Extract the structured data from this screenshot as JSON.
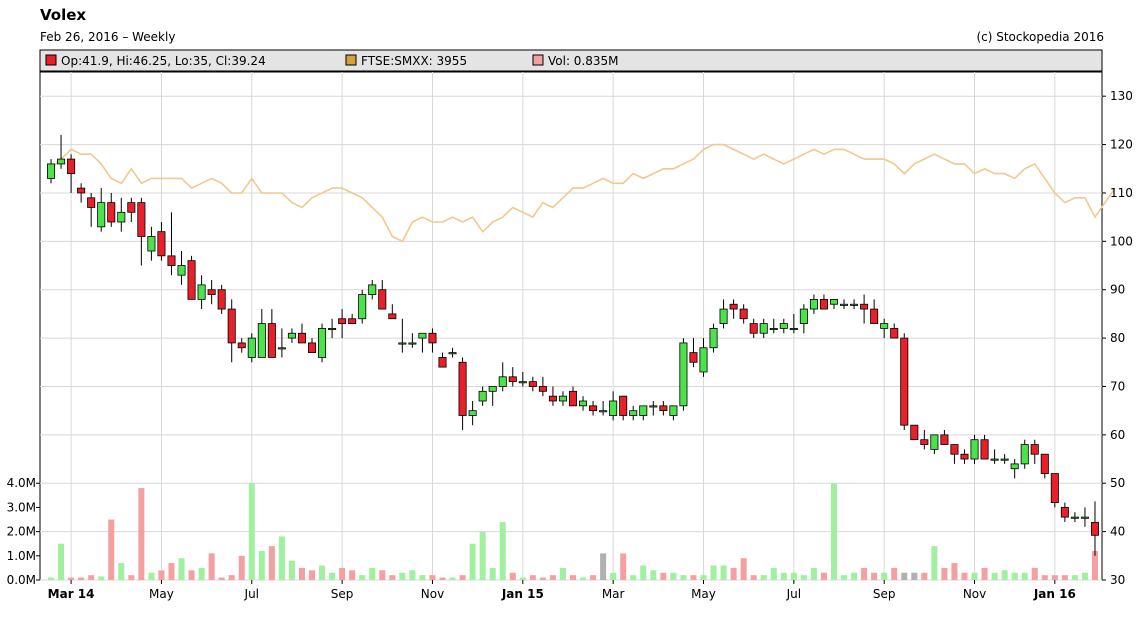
{
  "header": {
    "title": "Volex",
    "subtitle": "Feb 26, 2016 – Weekly",
    "credit": "(c) Stockopedia 2016"
  },
  "legend": [
    {
      "label": "Op:41.9, Hi:46.25, Lo:35, Cl:39.24",
      "color": "#e8202a"
    },
    {
      "label": "FTSE:SMXX: 3955",
      "color": "#d4a040"
    },
    {
      "label": "Vol: 0.835M",
      "color": "#f4a0a0"
    }
  ],
  "colors": {
    "up": "#4ce24c",
    "down": "#e8202a",
    "index_line": "#f0c890",
    "vol_up": "#a0f0a0",
    "vol_down": "#f4a0a0",
    "vol_neutral": "#b0b0b0",
    "grid": "#d8d8d8",
    "legend_bg": "#e4e4e4"
  },
  "chart_data": {
    "type": "candlestick",
    "price_axis": {
      "min": 30,
      "max": 135,
      "ticks": [
        "130",
        "120",
        "110",
        "100",
        "90",
        "80",
        "70",
        "60",
        "50",
        "40",
        "30"
      ],
      "side": "right"
    },
    "volume_axis": {
      "min": 0,
      "max": 4.0,
      "unit": "M",
      "ticks": [
        "4.0M",
        "3.0M",
        "2.0M",
        "1.0M",
        "0.0M"
      ],
      "side": "left"
    },
    "x_ticks": [
      {
        "label": "Mar 14",
        "bold": true,
        "week": 2
      },
      {
        "label": "May",
        "bold": false,
        "week": 11
      },
      {
        "label": "Jul",
        "bold": false,
        "week": 20
      },
      {
        "label": "Sep",
        "bold": false,
        "week": 29
      },
      {
        "label": "Nov",
        "bold": false,
        "week": 38
      },
      {
        "label": "Jan 15",
        "bold": true,
        "week": 47
      },
      {
        "label": "Mar",
        "bold": false,
        "week": 56
      },
      {
        "label": "May",
        "bold": false,
        "week": 65
      },
      {
        "label": "Jul",
        "bold": false,
        "week": 74
      },
      {
        "label": "Sep",
        "bold": false,
        "week": 83
      },
      {
        "label": "Nov",
        "bold": false,
        "week": 92
      },
      {
        "label": "Jan 16",
        "bold": true,
        "week": 100
      }
    ],
    "ohlc": [
      [
        113,
        117,
        112,
        116
      ],
      [
        116,
        122,
        115,
        117
      ],
      [
        117,
        118,
        110,
        114
      ],
      [
        111,
        112,
        108,
        110
      ],
      [
        109,
        110,
        103,
        107
      ],
      [
        103,
        111,
        102,
        108
      ],
      [
        108,
        110,
        103,
        104
      ],
      [
        104,
        109,
        102,
        106
      ],
      [
        108,
        109,
        104,
        106
      ],
      [
        108,
        109,
        95,
        101
      ],
      [
        98,
        103,
        96,
        101
      ],
      [
        102,
        104,
        96,
        97
      ],
      [
        97,
        106,
        93,
        95
      ],
      [
        93,
        98,
        91,
        95
      ],
      [
        96,
        97,
        88,
        88
      ],
      [
        88,
        93,
        86,
        91
      ],
      [
        90,
        92,
        87,
        89
      ],
      [
        90,
        91,
        85,
        86
      ],
      [
        86,
        88,
        75,
        79
      ],
      [
        79,
        80,
        77,
        78
      ],
      [
        76,
        81,
        75,
        80
      ],
      [
        76,
        86,
        76,
        83
      ],
      [
        83,
        86,
        76,
        76
      ],
      [
        78,
        82,
        76,
        78
      ],
      [
        80,
        82,
        79,
        81
      ],
      [
        81,
        83,
        79,
        79
      ],
      [
        79,
        80,
        77,
        77
      ],
      [
        76,
        83,
        75,
        82
      ],
      [
        82,
        84,
        80,
        82
      ],
      [
        84,
        86,
        80,
        83
      ],
      [
        84,
        85,
        83,
        83
      ],
      [
        84,
        90,
        83,
        89
      ],
      [
        89,
        92,
        88,
        91
      ],
      [
        90,
        92,
        86,
        86
      ],
      [
        85,
        87,
        84,
        84
      ],
      [
        79,
        84,
        77,
        79
      ],
      [
        79,
        81,
        78,
        79
      ],
      [
        80,
        81,
        77,
        81
      ],
      [
        81,
        82,
        77,
        79
      ],
      [
        76,
        77,
        74,
        74
      ],
      [
        77,
        78,
        76,
        77
      ],
      [
        75,
        76,
        61,
        64
      ],
      [
        64,
        67,
        62,
        65
      ],
      [
        67,
        70,
        66,
        69
      ],
      [
        69,
        70,
        66,
        70
      ],
      [
        70,
        75,
        69,
        72
      ],
      [
        72,
        74,
        70,
        71
      ],
      [
        71,
        73,
        70,
        71
      ],
      [
        71,
        72,
        69,
        70
      ],
      [
        70,
        72,
        68,
        69
      ],
      [
        68,
        70,
        66,
        67
      ],
      [
        67,
        69,
        66,
        68
      ],
      [
        69,
        70,
        66,
        66
      ],
      [
        66,
        68,
        65,
        67
      ],
      [
        66,
        67,
        64,
        65
      ],
      [
        65,
        67,
        64,
        65
      ],
      [
        64,
        69,
        63,
        67
      ],
      [
        68,
        68,
        63,
        64
      ],
      [
        64,
        66,
        63,
        65
      ],
      [
        64,
        66,
        63,
        66
      ],
      [
        66,
        67,
        64,
        66
      ],
      [
        66,
        67,
        64,
        65
      ],
      [
        64,
        66,
        63,
        66
      ],
      [
        66,
        80,
        65,
        79
      ],
      [
        77,
        80,
        74,
        75
      ],
      [
        73,
        80,
        72,
        78
      ],
      [
        78,
        83,
        77,
        82
      ],
      [
        83,
        88,
        82,
        86
      ],
      [
        87,
        88,
        84,
        86
      ],
      [
        86,
        87,
        83,
        84
      ],
      [
        83,
        84,
        80,
        81
      ],
      [
        81,
        84,
        80,
        83
      ],
      [
        82,
        84,
        81,
        82
      ],
      [
        82,
        84,
        81,
        83
      ],
      [
        82,
        85,
        81,
        82
      ],
      [
        83,
        87,
        81,
        86
      ],
      [
        86,
        89,
        85,
        88
      ],
      [
        88,
        89,
        86,
        86
      ],
      [
        87,
        88,
        86,
        88
      ],
      [
        87,
        88,
        86,
        87
      ],
      [
        87,
        88,
        86,
        87
      ],
      [
        87,
        89,
        83,
        86
      ],
      [
        86,
        88,
        83,
        83
      ],
      [
        82,
        84,
        80,
        83
      ],
      [
        82,
        83,
        80,
        80
      ],
      [
        80,
        81,
        61,
        62
      ],
      [
        62,
        62,
        59,
        59
      ],
      [
        59,
        61,
        57,
        58
      ],
      [
        57,
        60,
        56,
        60
      ],
      [
        60,
        61,
        58,
        58
      ],
      [
        58,
        58,
        54,
        56
      ],
      [
        56,
        57,
        54,
        55
      ],
      [
        55,
        60,
        54,
        59
      ],
      [
        59,
        60,
        55,
        55
      ],
      [
        55,
        57,
        54,
        55
      ],
      [
        55,
        56,
        54,
        55
      ],
      [
        53,
        55,
        51,
        54
      ],
      [
        54,
        59,
        53,
        58
      ],
      [
        58,
        59,
        54,
        56
      ],
      [
        56,
        56,
        51,
        52
      ],
      [
        52,
        52,
        45,
        46
      ],
      [
        45,
        46,
        42,
        43
      ],
      [
        43,
        44,
        42,
        43
      ],
      [
        43,
        45,
        41,
        43
      ],
      [
        41.9,
        46.25,
        35,
        39.24
      ]
    ],
    "volume_M": [
      0.1,
      1.5,
      0.1,
      0.1,
      0.2,
      0.15,
      2.5,
      0.7,
      0.2,
      3.8,
      0.3,
      0.4,
      0.7,
      0.9,
      0.4,
      0.5,
      1.1,
      0.1,
      0.2,
      1.0,
      4.0,
      1.2,
      1.4,
      1.8,
      0.8,
      0.5,
      0.4,
      0.6,
      0.3,
      0.5,
      0.4,
      0.2,
      0.5,
      0.4,
      0.2,
      0.3,
      0.4,
      0.2,
      0.2,
      0.1,
      0.1,
      0.2,
      1.5,
      2.0,
      0.5,
      2.4,
      0.3,
      0.1,
      0.2,
      0.1,
      0.2,
      0.5,
      0.2,
      0.1,
      0.2,
      1.1,
      0.3,
      1.1,
      0.2,
      0.6,
      0.4,
      0.3,
      0.3,
      0.2,
      0.2,
      0.2,
      0.6,
      0.6,
      0.5,
      0.9,
      0.2,
      0.2,
      0.5,
      0.3,
      0.3,
      0.2,
      0.5,
      0.3,
      4.0,
      0.2,
      0.3,
      0.5,
      0.3,
      0.3,
      0.5,
      0.3,
      0.3,
      0.3,
      1.4,
      0.5,
      0.7,
      0.3,
      0.3,
      0.5,
      0.3,
      0.4,
      0.3,
      0.3,
      0.5,
      0.2,
      0.2,
      0.2,
      0.2,
      0.3,
      1.2,
      0.6,
      0.2,
      0.3,
      0.8
    ],
    "volume_neutral_weeks": [
      55,
      85,
      86,
      107
    ],
    "index_line": [
      115,
      117,
      119,
      118,
      118,
      116,
      113,
      112,
      115,
      112,
      113,
      113,
      113,
      113,
      111,
      112,
      113,
      112,
      110,
      110,
      113,
      110,
      110,
      110,
      108,
      107,
      109,
      110,
      111,
      111,
      110,
      109,
      107,
      105,
      101,
      100,
      104,
      105,
      104,
      104,
      105,
      104,
      105,
      102,
      104,
      105,
      107,
      106,
      105,
      108,
      107,
      109,
      111,
      111,
      112,
      113,
      112,
      112,
      114,
      113,
      114,
      115,
      115,
      116,
      117,
      119,
      120,
      120,
      119,
      118,
      117,
      118,
      117,
      116,
      117,
      118,
      119,
      118,
      119,
      119,
      118,
      117,
      117,
      117,
      116,
      114,
      116,
      117,
      118,
      117,
      116,
      116,
      114,
      115,
      114,
      114,
      113,
      115,
      116,
      113,
      110,
      108,
      109,
      109,
      105,
      108,
      111
    ]
  }
}
